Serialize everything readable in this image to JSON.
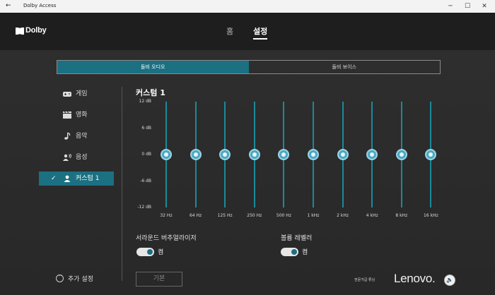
{
  "window": {
    "title": "Dolby Access",
    "back_glyph": "←",
    "minimize": "─",
    "maximize": "☐",
    "close": "✕"
  },
  "header": {
    "logo_text": "Dolby",
    "tabs": [
      {
        "label": "홈"
      },
      {
        "label": "설정"
      }
    ]
  },
  "segment": {
    "items": [
      {
        "label": "돌비 오디오"
      },
      {
        "label": "돌비 보이스"
      }
    ],
    "selected": 0
  },
  "sidebar": {
    "items": [
      {
        "label": "게임",
        "icon": "gamepad-icon"
      },
      {
        "label": "영화",
        "icon": "film-icon"
      },
      {
        "label": "음악",
        "icon": "music-note-icon"
      },
      {
        "label": "음성",
        "icon": "voice-icon"
      },
      {
        "label": "커스텀 1",
        "icon": "person-icon",
        "checked": true
      }
    ],
    "more_label": "추가 설정"
  },
  "equalizer": {
    "title": "커스텀 1",
    "y_labels": [
      "12 dB",
      "6 dB",
      "0 dB",
      "-6 dB",
      "-12 dB"
    ],
    "bands": [
      "32 Hz",
      "64 Hz",
      "125 Hz",
      "250 Hz",
      "500 Hz",
      "1 kHz",
      "2 kHz",
      "4 kHz",
      "8 kHz",
      "16 kHz"
    ],
    "gains_db": [
      0,
      0,
      0,
      0,
      0,
      0,
      0,
      0,
      0,
      0
    ],
    "range_db": [
      -12,
      12
    ]
  },
  "options": {
    "surround": {
      "label": "서라운드 버추얼라이저",
      "state": "켬",
      "on": true
    },
    "leveler": {
      "label": "볼륨 레벨러",
      "state": "켬",
      "on": true
    }
  },
  "reset_label": "기본",
  "footer": {
    "tuned_text": "전문가급 튜닝",
    "brand": "Lenovo."
  },
  "colors": {
    "accent": "#1b7082",
    "knob": "#4aa8c4",
    "band": "#1b8a99"
  }
}
